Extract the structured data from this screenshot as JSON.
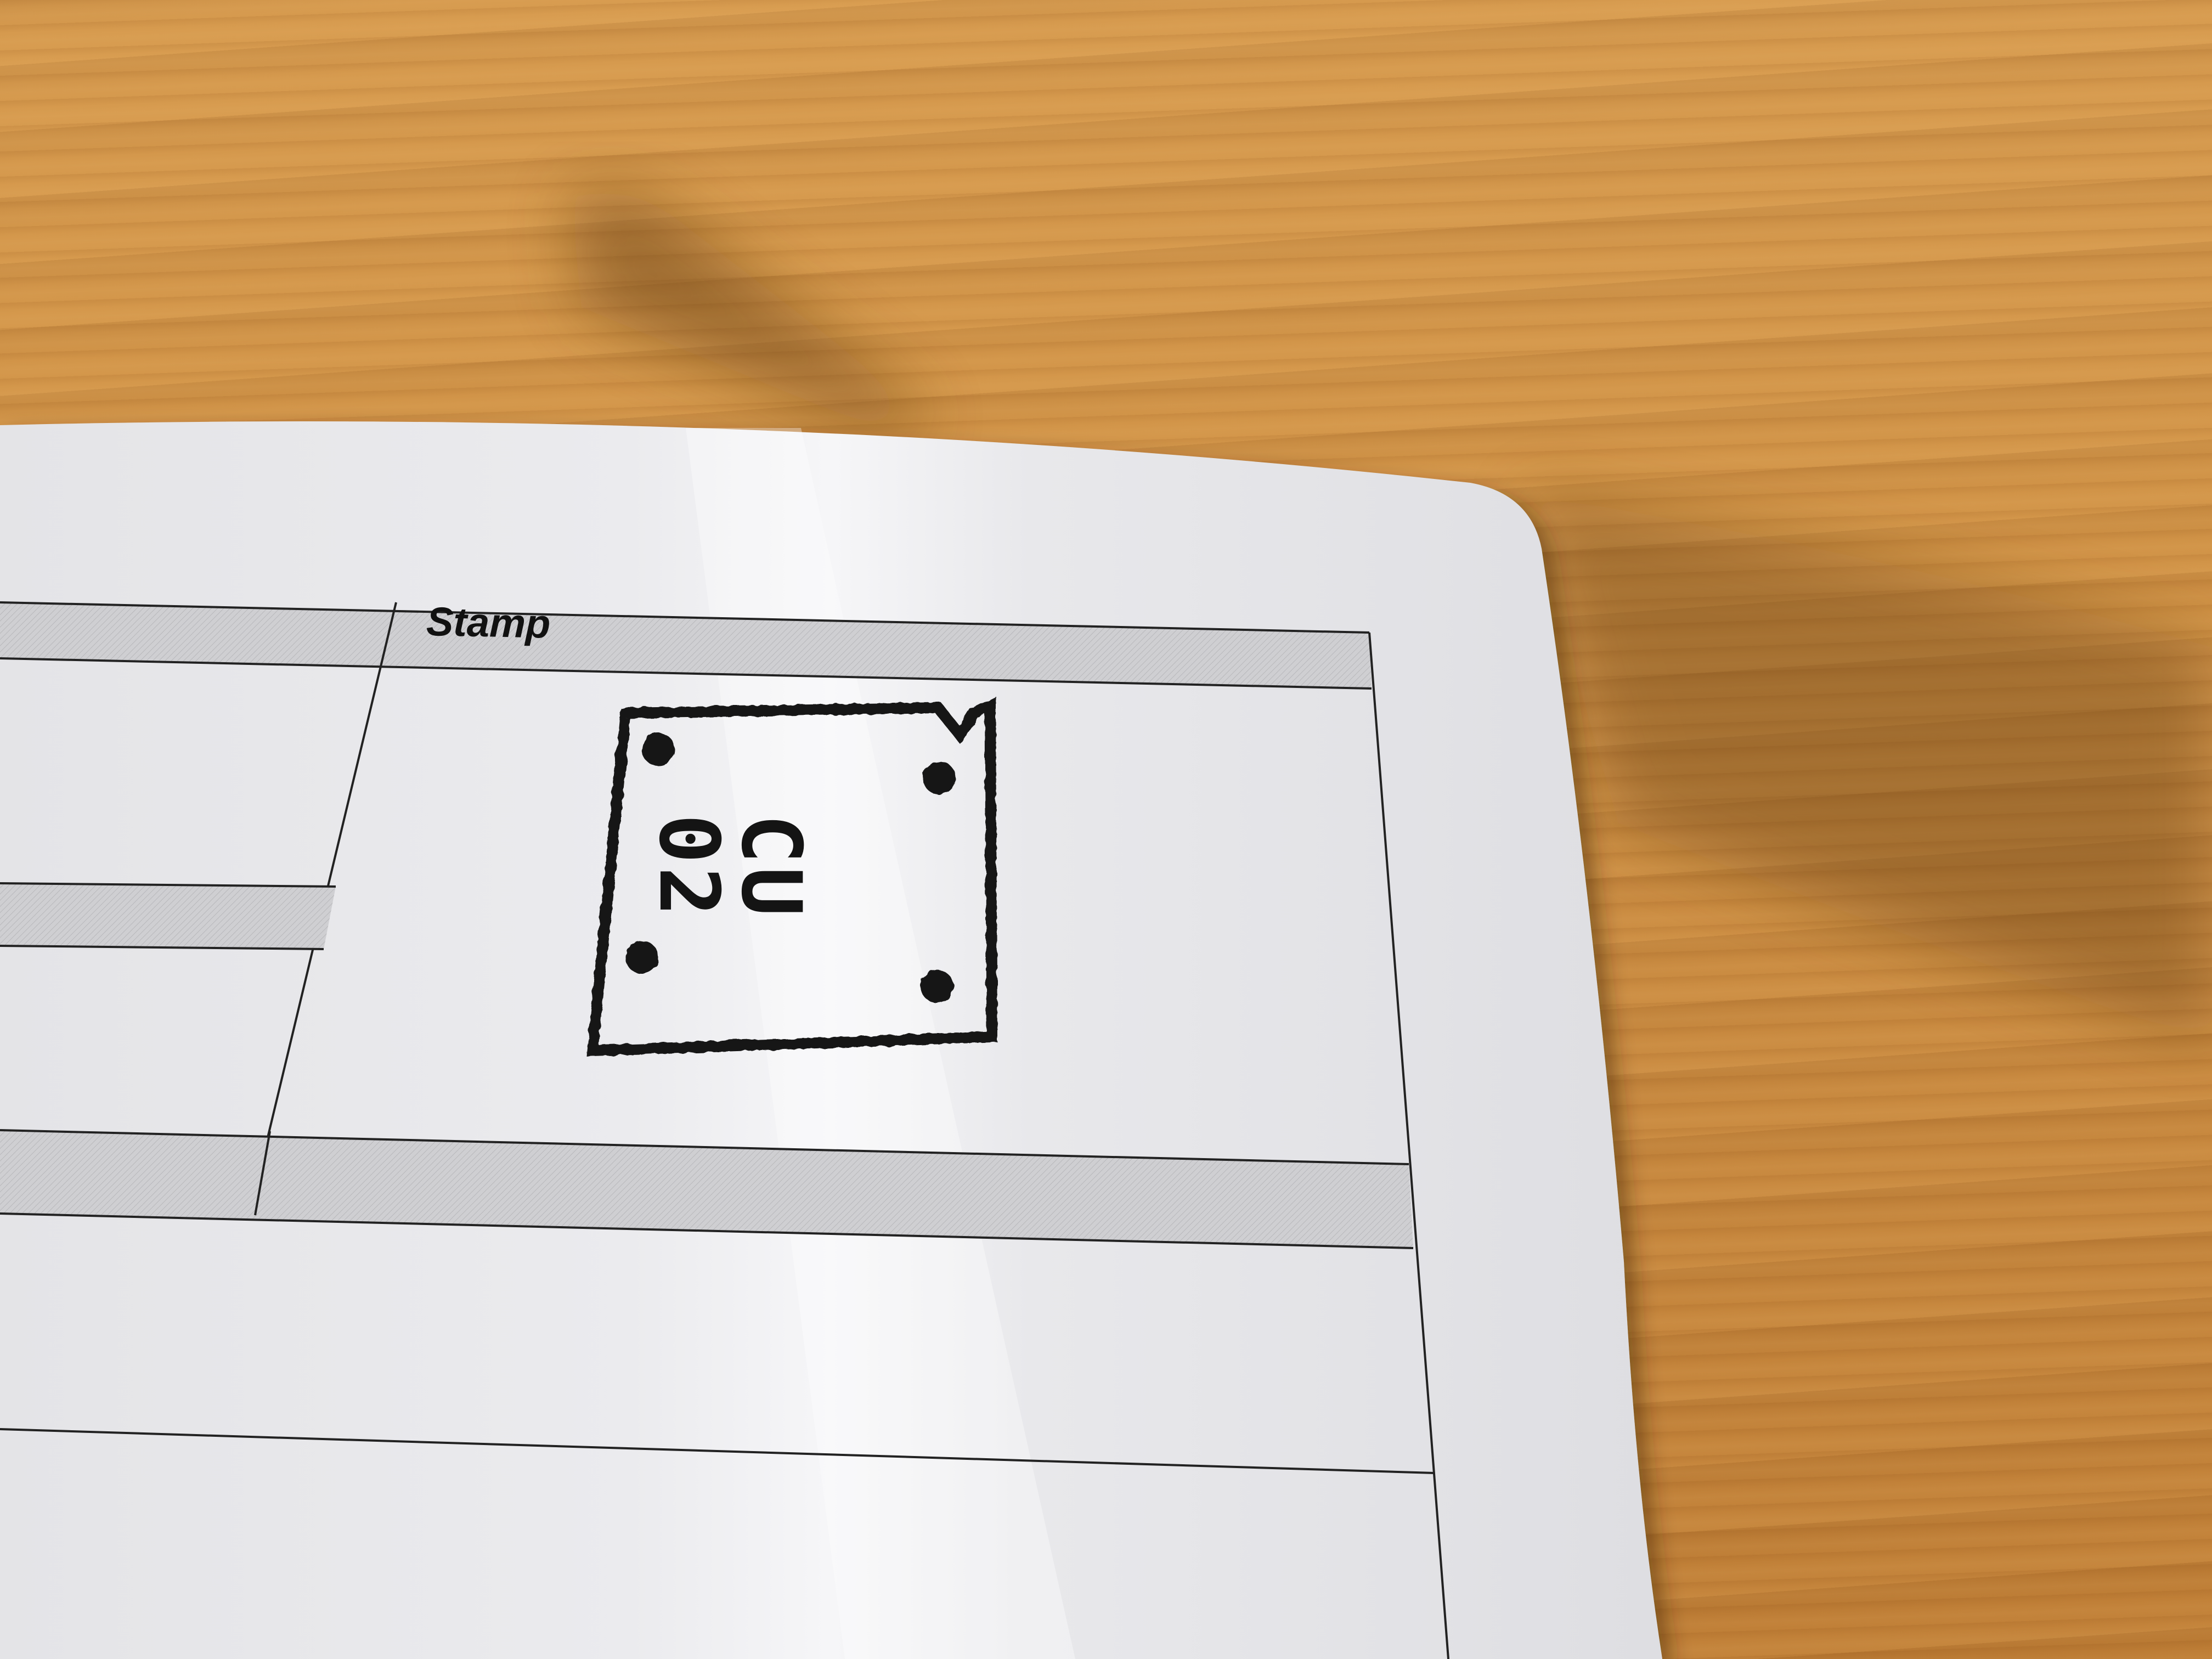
{
  "form": {
    "section_header": "Stamp"
  },
  "stamp": {
    "line1": "CU",
    "line2": "02",
    "ink_color": "#141414"
  },
  "colors": {
    "wood": "#cf9145",
    "paper": "#ececee",
    "header_band": "#c9c9cc"
  }
}
